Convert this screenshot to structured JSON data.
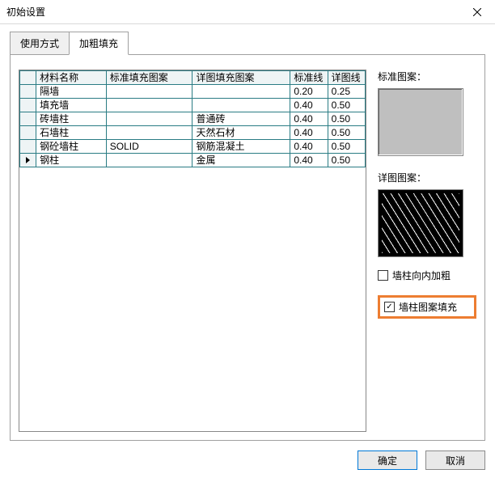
{
  "window": {
    "title": "初始设置"
  },
  "tabs": [
    {
      "label": "使用方式",
      "active": false
    },
    {
      "label": "加粗填充",
      "active": true
    }
  ],
  "grid": {
    "columns": [
      "材料名称",
      "标准填充图案",
      "详图填充图案",
      "标准线",
      "详图线"
    ],
    "rows": [
      {
        "name": "隔墙",
        "std": "",
        "detail": "",
        "w1": "0.20",
        "w2": "0.25",
        "current": false
      },
      {
        "name": "填充墙",
        "std": "",
        "detail": "",
        "w1": "0.40",
        "w2": "0.50",
        "current": false
      },
      {
        "name": "砖墙柱",
        "std": "",
        "detail": "普通砖",
        "w1": "0.40",
        "w2": "0.50",
        "current": false
      },
      {
        "name": "石墙柱",
        "std": "",
        "detail": "天然石材",
        "w1": "0.40",
        "w2": "0.50",
        "current": false
      },
      {
        "name": "钢砼墙柱",
        "std": "SOLID",
        "detail": "钢筋混凝土",
        "w1": "0.40",
        "w2": "0.50",
        "current": false
      },
      {
        "name": "钢柱",
        "std": "",
        "detail": "金属",
        "w1": "0.40",
        "w2": "0.50",
        "current": true
      }
    ]
  },
  "right": {
    "std_label": "标准图案：",
    "detail_label": "详图图案：",
    "chk_bold_inward": {
      "label": "墙柱向内加粗",
      "checked": false
    },
    "chk_pattern_fill": {
      "label": "墙柱图案填充",
      "checked": true
    }
  },
  "footer": {
    "ok": "确定",
    "cancel": "取消"
  }
}
